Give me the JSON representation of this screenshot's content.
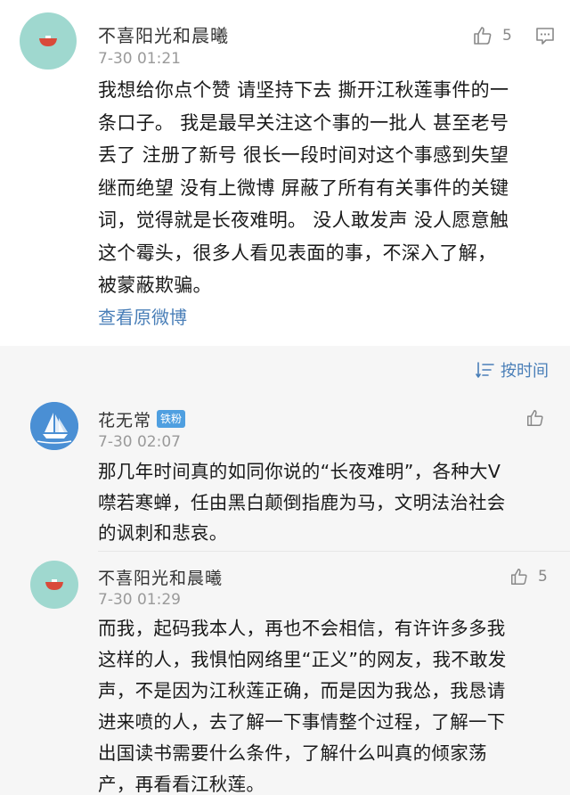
{
  "post": {
    "author": "不喜阳光和晨曦",
    "time": "7-30 01:21",
    "like_count": "5",
    "lines": [
      "我想给你点个赞 请坚持下去 撕开江秋莲事件的一",
      "条口子。 我是最早关注这个事的一批人 甚至老号",
      "丢了 注册了新号 很长一段时间对这个事感到失望",
      "继而绝望 没有上微博 屏蔽了所有有关事件的关键",
      "词，觉得就是长夜难明。 没人敢发声 没人愿意触",
      "这个霉头，很多人看见表面的事，不深入了解，",
      "被蒙蔽欺骗。"
    ],
    "view_original_label": "查看原微博"
  },
  "sort": {
    "label": "按时间"
  },
  "comments": [
    {
      "author": "花无常",
      "badge": "铁粉",
      "time": "7-30 02:07",
      "lines": [
        "那几年时间真的如同你说的“长夜难明”，各种大V",
        "噤若寒蝉，任由黑白颠倒指鹿为马，文明法治社会",
        "的讽刺和悲哀。"
      ]
    },
    {
      "author": "不喜阳光和晨曦",
      "time": "7-30 01:29",
      "like_count": "5",
      "lines": [
        "而我，起码我本人，再也不会相信，有许许多多我",
        "这样的人，我惧怕网络里“正义”的网友，我不敢发",
        "声，不是因为江秋莲正确，而是因为我怂，我恳请",
        "进来喷的人，去了解一下事情整个过程，了解一下",
        "出国读书需要什么条件，了解什么叫真的倾家荡",
        "产，再看看江秋莲。"
      ]
    }
  ],
  "colors": {
    "link": "#4a7fb8",
    "badge": "#4f9fe0",
    "avatar_mint": "#9fd8cf",
    "section_bg": "#f6f6f6"
  },
  "icons": [
    "bowl-avatar-icon",
    "thumbs-up-icon",
    "comment-icon",
    "sort-icon",
    "sailboat-avatar-icon"
  ]
}
